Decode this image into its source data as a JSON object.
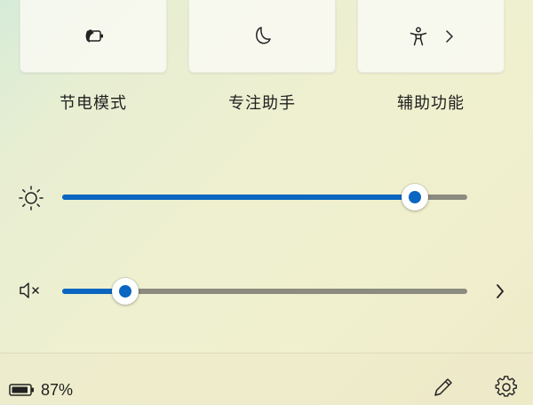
{
  "quick_settings": {
    "tiles": [
      {
        "icon": "battery-saver-icon",
        "label": "节电模式"
      },
      {
        "icon": "focus-assist-moon-icon",
        "label": "专注助手"
      },
      {
        "icon": "accessibility-icon",
        "label": "辅助功能",
        "has_submenu": true
      }
    ]
  },
  "brightness": {
    "icon": "brightness-sun-icon",
    "level_fraction": 0.87
  },
  "volume": {
    "icon": "volume-muted-icon",
    "level_fraction": 0.155,
    "expand_icon": "chevron-right-icon"
  },
  "footer": {
    "battery_icon": "battery-icon",
    "battery_text": "87%",
    "edit_icon": "pencil-icon",
    "settings_icon": "gear-icon"
  },
  "colors": {
    "accent": "#0a66c0",
    "track": "#8b8b80"
  }
}
